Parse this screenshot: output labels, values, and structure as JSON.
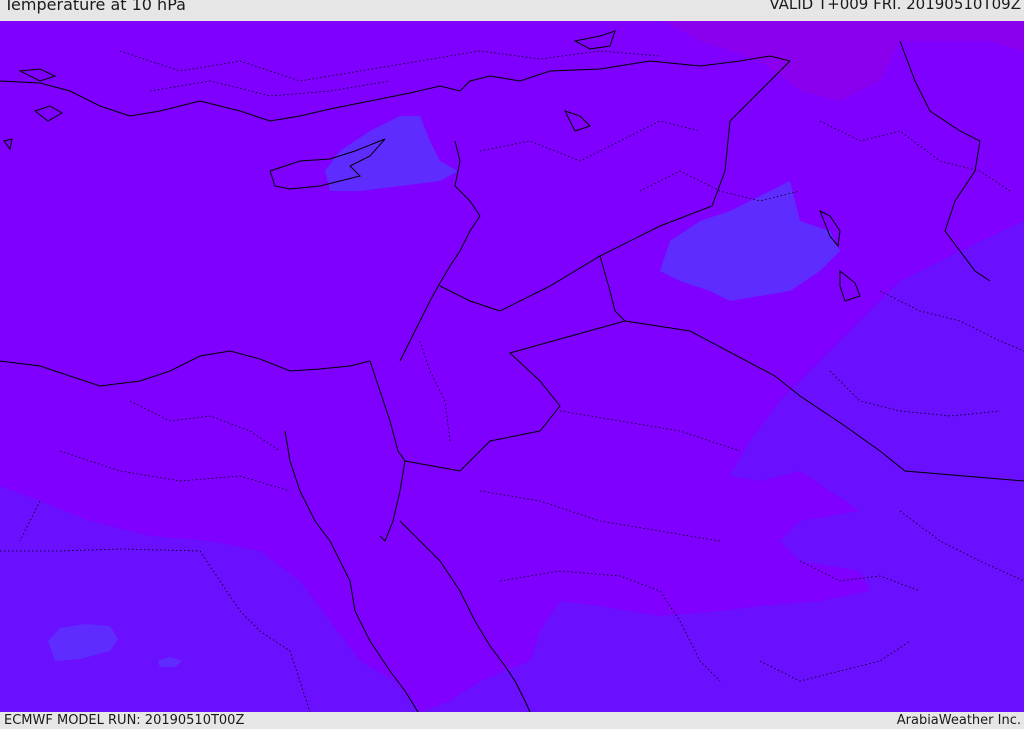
{
  "header": {
    "title": "Temperature at 10 hPa",
    "valid": "VALID T+009 FRI. 20190510T09Z"
  },
  "footer": {
    "model_run": "ECMWF MODEL RUN: 20190510T00Z",
    "credit": "ArabiaWeather Inc."
  },
  "map": {
    "colors": {
      "base_fill": "#7f00ff",
      "cooler_fill": "#6a10ff",
      "cool_patch": "#5f2cff",
      "warm_patch": "#8a00ee",
      "coastline": "#000000",
      "border": "#000000"
    },
    "layers": [
      "temperature-fill",
      "coastlines",
      "country-borders",
      "province-borders"
    ]
  }
}
